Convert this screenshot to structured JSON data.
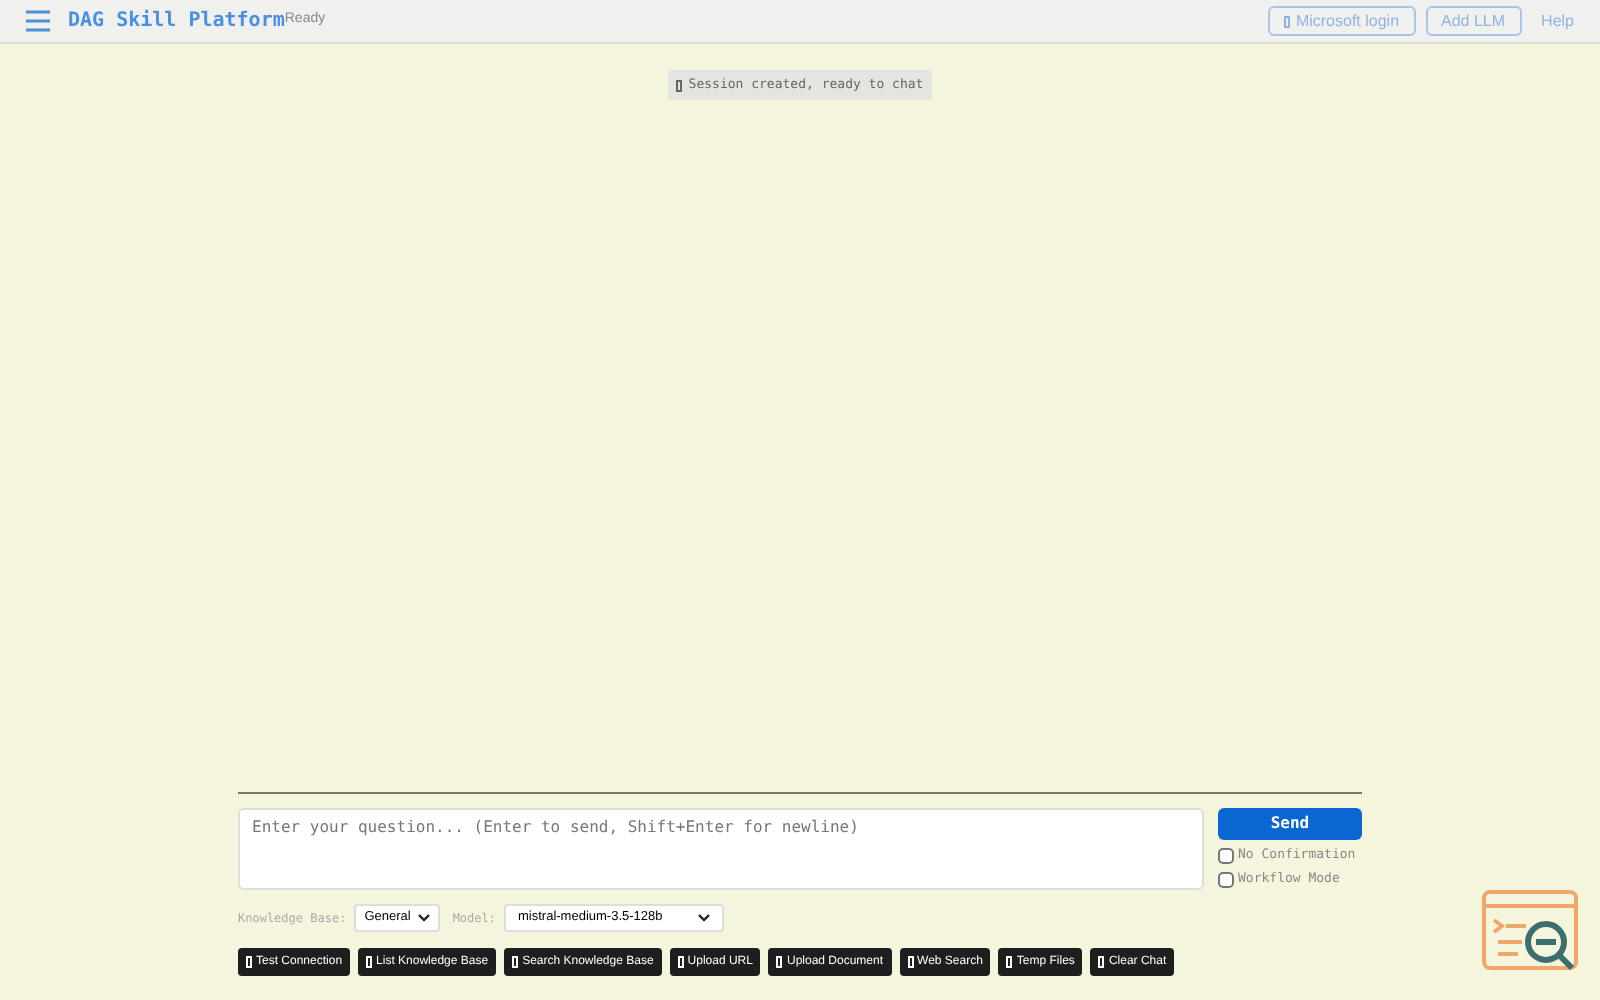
{
  "header": {
    "title": "DAG Skill Platform",
    "status": "Ready",
    "buttons": [
      {
        "label": "Microsoft login",
        "glyph": true
      },
      {
        "label": "Add LLM",
        "glyph": false
      }
    ],
    "link": "Help"
  },
  "toast": "Session created, ready to chat",
  "composer": {
    "placeholder": "Enter your question... (Enter to send, Shift+Enter for newline)",
    "send": "Send",
    "options": [
      {
        "label": "No Confirmation",
        "checked": false
      },
      {
        "label": "Workflow Mode",
        "checked": false
      }
    ],
    "knowledge_base": {
      "label": "Knowledge Base:",
      "value": "General"
    },
    "model": {
      "label": "Model:",
      "value": "mistral-medium-3.5-128b"
    }
  },
  "actions": [
    {
      "label": "Test Connection"
    },
    {
      "label": "List Knowledge Base"
    },
    {
      "label": "Search Knowledge Base"
    },
    {
      "label": "Upload URL"
    },
    {
      "label": "Upload Document"
    },
    {
      "label": "Web Search"
    },
    {
      "label": "Temp Files"
    },
    {
      "label": "Clear Chat"
    }
  ]
}
